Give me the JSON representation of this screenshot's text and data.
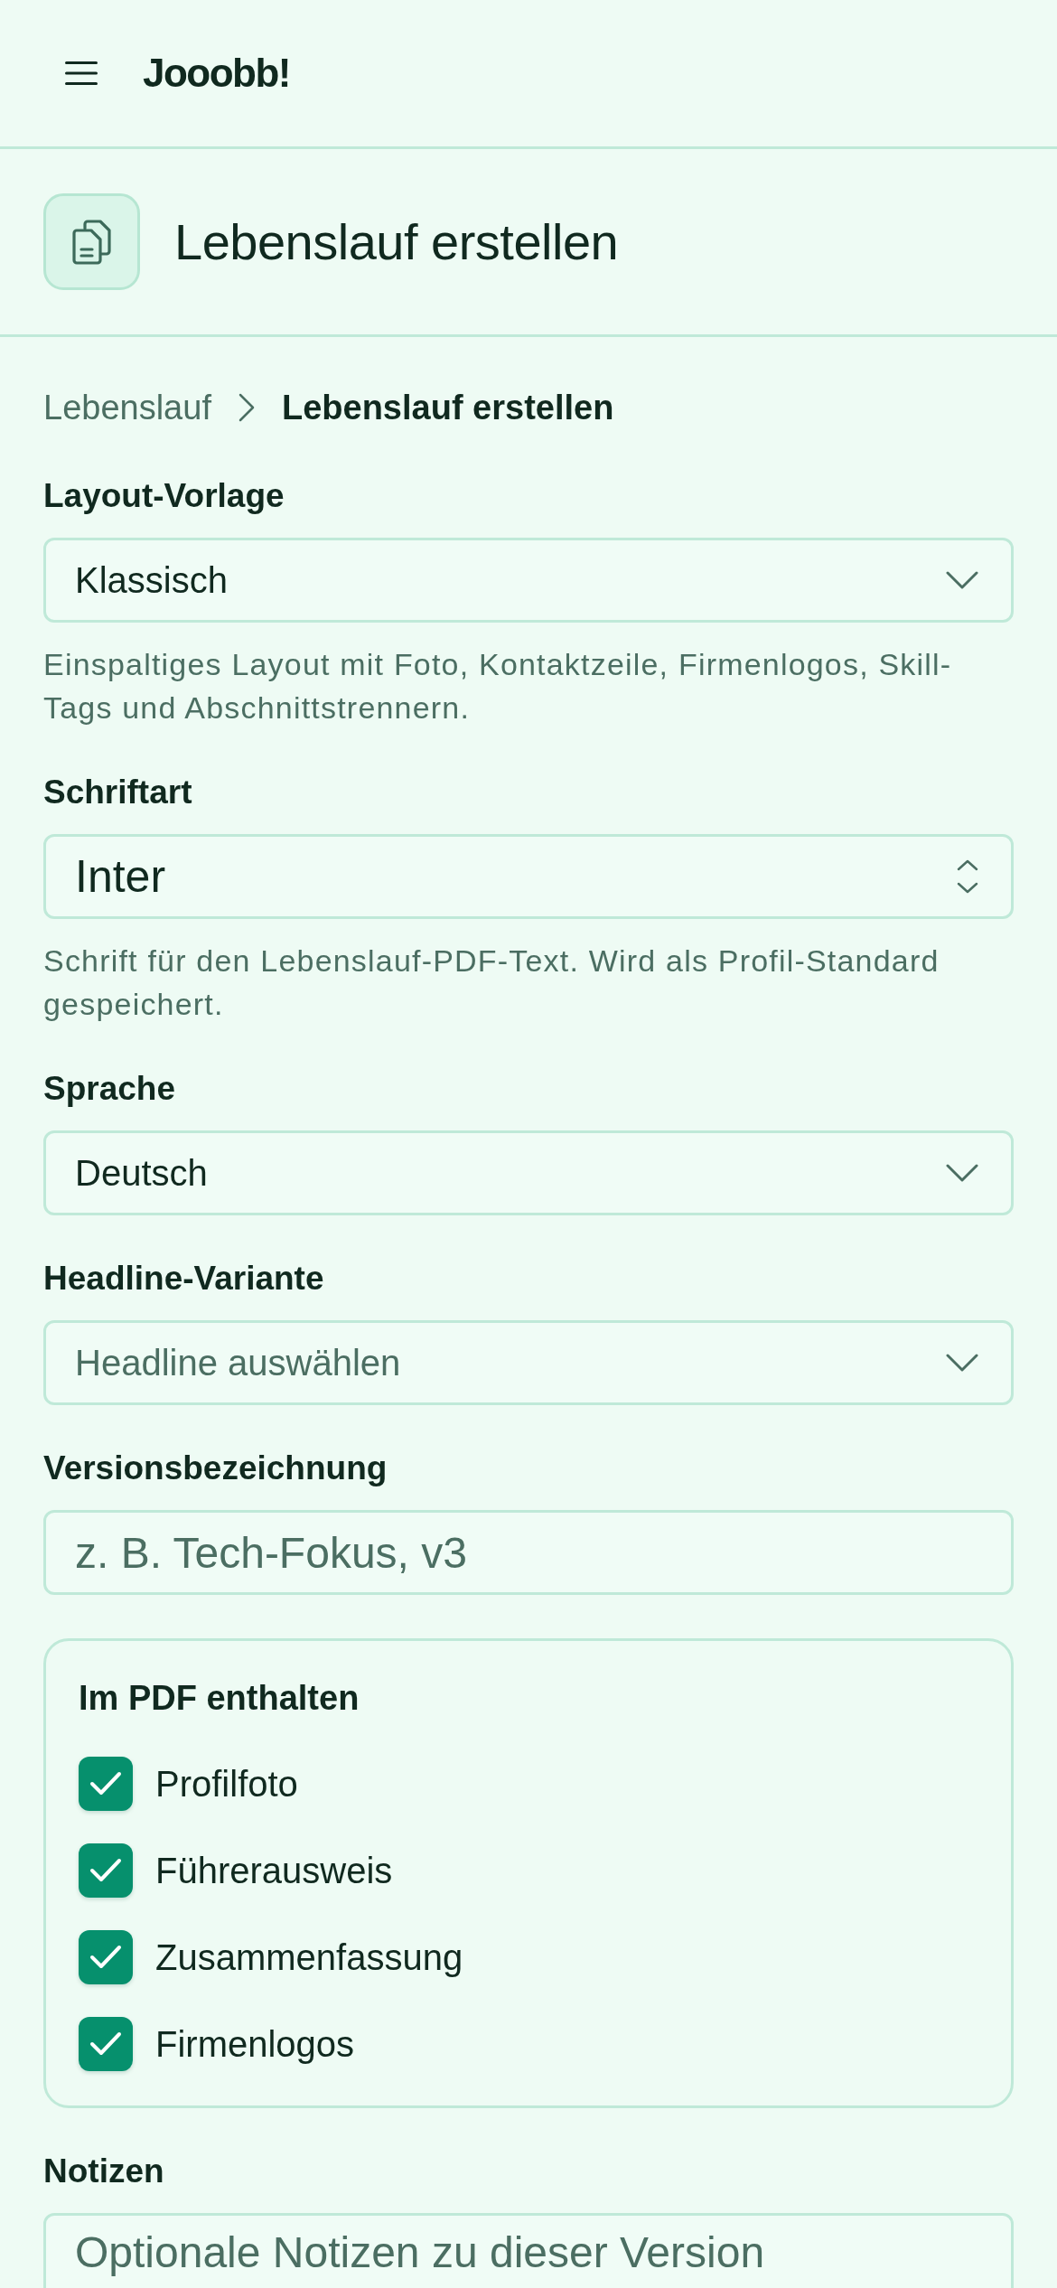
{
  "app_bar": {
    "brand": "Jooobb!"
  },
  "page_header": {
    "title": "Lebenslauf erstellen"
  },
  "breadcrumb": [
    {
      "label": "Lebenslauf",
      "current": false
    },
    {
      "label": "Lebenslauf erstellen",
      "current": true
    }
  ],
  "fields": [
    {
      "kind": "select",
      "label": "Layout-Vorlage",
      "value": "Klassisch",
      "help": "Einspaltiges Layout mit Foto, Kontaktzeile, Firmenlogos, Skill-Tags und Abschnittstrennern."
    },
    {
      "kind": "native_select",
      "label": "Schriftart",
      "value": "Inter",
      "help": "Schrift für den Lebenslauf-PDF-Text. Wird als Profil-Standard gespeichert."
    },
    {
      "kind": "select",
      "label": "Sprache",
      "value": "Deutsch"
    },
    {
      "kind": "select",
      "label": "Headline-Variante",
      "placeholder": "Headline auswählen"
    },
    {
      "kind": "text",
      "label": "Versionsbezeichnung",
      "placeholder": "z. B. Tech-Fokus, v3"
    }
  ],
  "include_card": {
    "title": "Im PDF enthalten",
    "options": [
      {
        "label": "Profilfoto",
        "checked": true
      },
      {
        "label": "Führerausweis",
        "checked": true
      },
      {
        "label": "Zusammenfassung",
        "checked": true
      },
      {
        "label": "Firmenlogos",
        "checked": true
      }
    ]
  },
  "notes": {
    "label": "Notizen",
    "placeholder": "Optionale Notizen zu dieser Version"
  }
}
